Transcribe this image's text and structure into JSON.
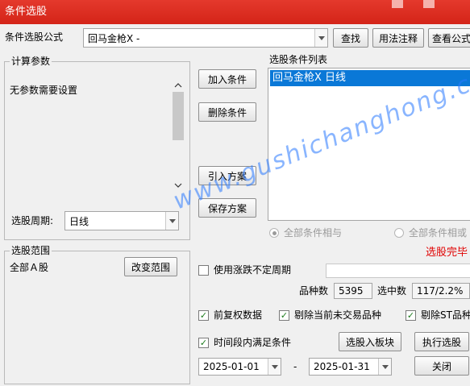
{
  "window": {
    "title": "条件选股"
  },
  "formula": {
    "label": "条件选股公式",
    "value": "回马金枪X  -",
    "find_button": "查找",
    "syntax_button": "用法注释",
    "view_button": "查看公式"
  },
  "params": {
    "group_label": "计算参数",
    "message": "无参数需要设置",
    "period_label": "选股周期:",
    "period_value": "日线"
  },
  "actions": {
    "add_condition": "加入条件",
    "delete_condition": "删除条件",
    "import_plan": "引入方案",
    "save_plan": "保存方案"
  },
  "conditions": {
    "list_label": "选股条件列表",
    "items": [
      "回马金枪X  日线"
    ],
    "radio_and": "全部条件相与",
    "radio_or": "全部条件相或",
    "status": "选股完毕"
  },
  "scope": {
    "group_label": "选股范围",
    "value": "全部Ａ股",
    "change_button": "改变范围"
  },
  "options": {
    "uncertain_period": "使用涨跌不定周期",
    "restore_rights": "前复权数据",
    "exclude_untraded": "剔除当前未交易品种",
    "exclude_st": "剔除ST品种",
    "time_range": "时间段内满足条件"
  },
  "stats": {
    "count_label": "品种数",
    "count_value": "5395",
    "selected_label": "选中数",
    "selected_value": "117/2.2%"
  },
  "dates": {
    "start": "2025-01-01",
    "separator": "-",
    "end": "2025-01-31"
  },
  "bottom_buttons": {
    "to_block": "选股入板块",
    "execute": "执行选股",
    "close": "关闭"
  },
  "watermark": "www.gushichanghong.com",
  "colors": {
    "title_bar": "#d9281c",
    "selection": "#0a78d7",
    "status": "#e00000",
    "watermark": "#2878ff"
  }
}
